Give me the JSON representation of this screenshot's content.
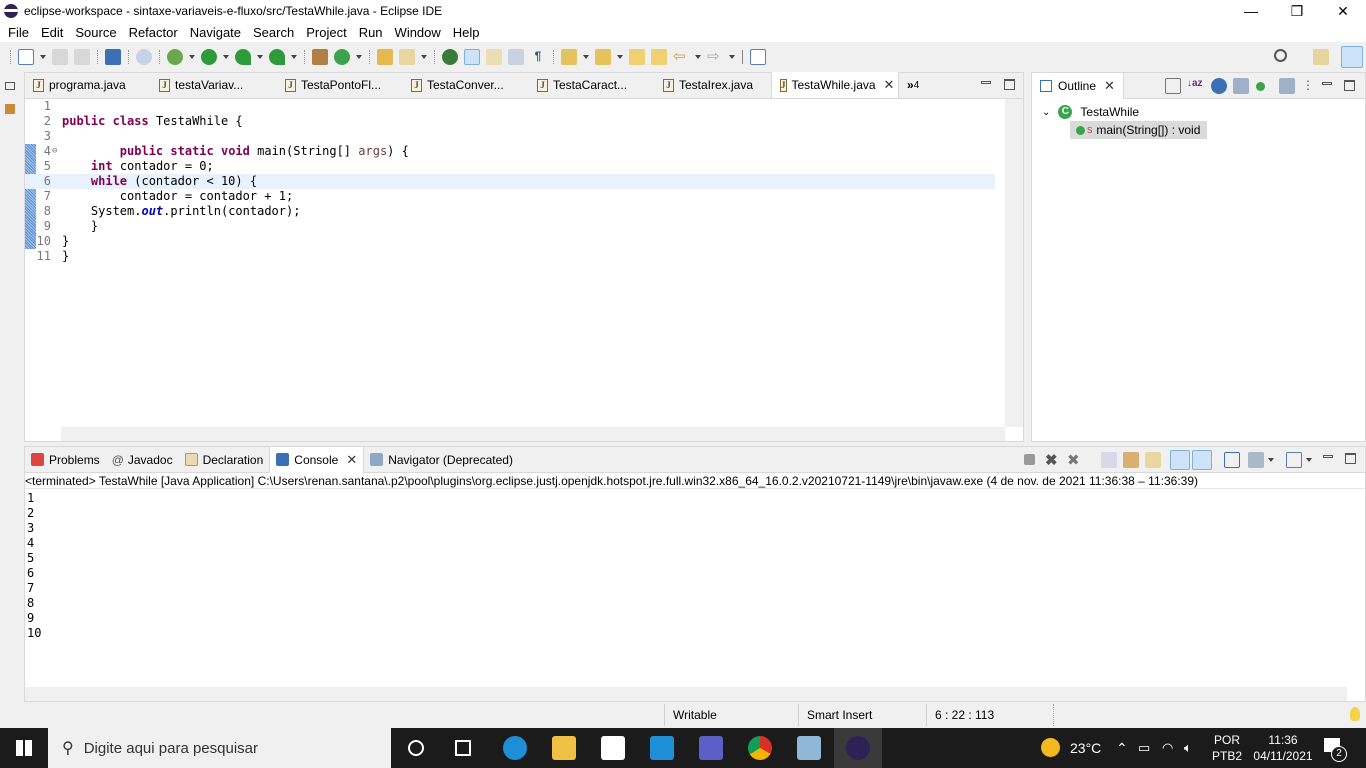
{
  "window": {
    "title": "eclipse-workspace - sintaxe-variaveis-e-fluxo/src/TestaWhile.java - Eclipse IDE",
    "minimize": "—",
    "restore": "❐",
    "close": "✕"
  },
  "menu": [
    "File",
    "Edit",
    "Source",
    "Refactor",
    "Navigate",
    "Search",
    "Project",
    "Run",
    "Window",
    "Help"
  ],
  "editor": {
    "tabs": [
      {
        "label": "programa.java"
      },
      {
        "label": "testaVariav..."
      },
      {
        "label": "TestaPontoFl..."
      },
      {
        "label": "TestaConver..."
      },
      {
        "label": "TestaCaract..."
      },
      {
        "label": "TestaIrex.java"
      },
      {
        "label": "TestaWhile.java",
        "active": true
      }
    ],
    "overflow_label": "»",
    "overflow_count": "4",
    "lines": [
      {
        "n": "1",
        "code": ""
      },
      {
        "n": "2",
        "code": "public class TestaWhile {"
      },
      {
        "n": "3",
        "code": ""
      },
      {
        "n": "4",
        "code": "        public static void main(String[] args) {"
      },
      {
        "n": "5",
        "code": "    int contador = 0;"
      },
      {
        "n": "6",
        "code": "    while (contador < 10) {"
      },
      {
        "n": "7",
        "code": "        contador = contador + 1;"
      },
      {
        "n": "8",
        "code": "    System.out.println(contador);"
      },
      {
        "n": "9",
        "code": "    }"
      },
      {
        "n": "10",
        "code": "}"
      },
      {
        "n": "11",
        "code": "}"
      }
    ],
    "current_line": 6
  },
  "outline": {
    "tab_label": "Outline",
    "class_name": "TestaWhile",
    "method": "main(String[]) : void",
    "method_modifier": "S"
  },
  "console": {
    "tabs": [
      {
        "label": "Problems"
      },
      {
        "label": "Javadoc"
      },
      {
        "label": "Declaration"
      },
      {
        "label": "Console",
        "active": true
      },
      {
        "label": "Navigator (Deprecated)"
      }
    ],
    "terminated": "<terminated> TestaWhile [Java Application] C:\\Users\\renan.santana\\.p2\\pool\\plugins\\org.eclipse.justj.openjdk.hotspot.jre.full.win32.x86_64_16.0.2.v20210721-1149\\jre\\bin\\javaw.exe  (4 de nov. de 2021 11:36:38 – 11:36:39)",
    "output": [
      "1",
      "2",
      "3",
      "4",
      "5",
      "6",
      "7",
      "8",
      "9",
      "10"
    ]
  },
  "status": {
    "writable": "Writable",
    "insert_mode": "Smart Insert",
    "position": "6 : 22 : 113"
  },
  "taskbar": {
    "search_placeholder": "Digite aqui para pesquisar",
    "weather": "23°C",
    "lang1": "POR",
    "lang2": "PTB2",
    "time": "11:36",
    "date": "04/11/2021",
    "notifications": "2"
  }
}
